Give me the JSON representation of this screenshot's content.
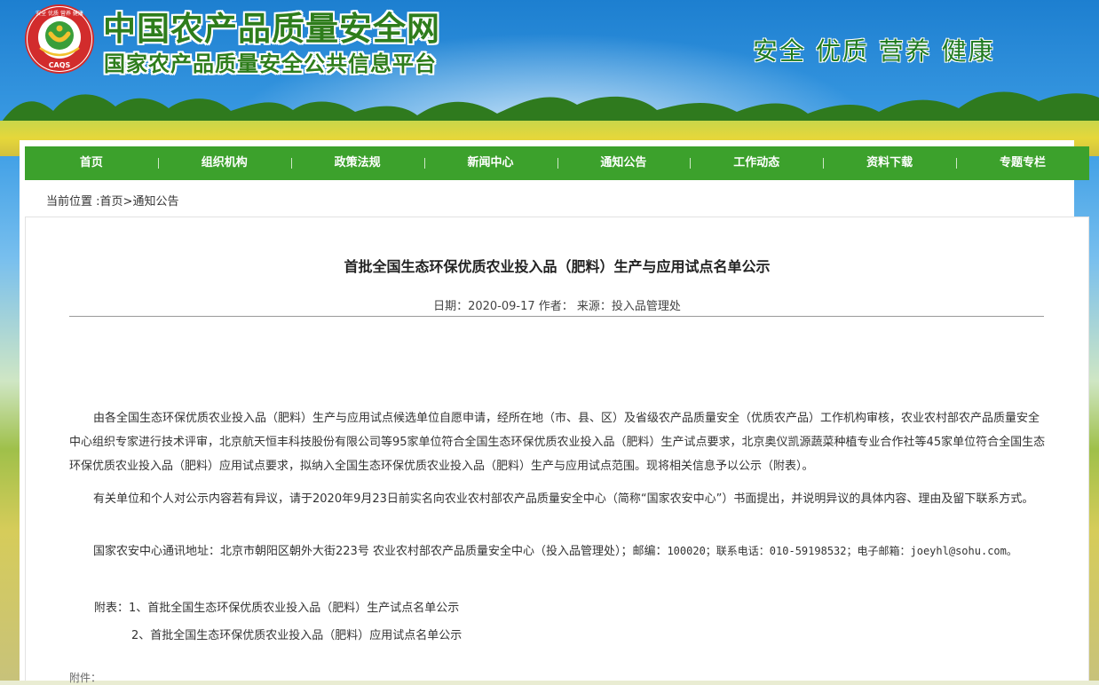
{
  "site": {
    "title": "中国农产品质量安全网",
    "subtitle": "国家农产品质量安全公共信息平台",
    "slogan": "安全 优质 营养 健康",
    "logo_text": "CAQS",
    "logo_ring_text": "安全 优质 营养 健康"
  },
  "nav": {
    "items": [
      "首页",
      "组织机构",
      "政策法规",
      "新闻中心",
      "通知公告",
      "工作动态",
      "资料下载",
      "专题专栏"
    ]
  },
  "breadcrumb": {
    "prefix": "当前位置 :",
    "home": "首页",
    "separator": ">",
    "current": "通知公告"
  },
  "article": {
    "title": "首批全国生态环保优质农业投入品（肥料）生产与应用试点名单公示",
    "meta": "日期：2020-09-17 作者： 来源：投入品管理处",
    "paragraph1": "由各全国生态环保优质农业投入品（肥料）生产与应用试点候选单位自愿申请，经所在地（市、县、区）及省级农产品质量安全（优质农产品）工作机构审核，农业农村部农产品质量安全中心组织专家进行技术评审，北京航天恒丰科技股份有限公司等95家单位符合全国生态环保优质农业投入品（肥料）生产试点要求，北京奥仪凯源蔬菜种植专业合作社等45家单位符合全国生态环保优质农业投入品（肥料）应用试点要求，拟纳入全国生态环保优质农业投入品（肥料）生产与应用试点范围。现将相关信息予以公示（附表）。",
    "paragraph2": "有关单位和个人对公示内容若有异议，请于2020年9月23日前实名向农业农村部农产品质量安全中心（简称“国家农安中心”）书面提出，并说明异议的具体内容、理由及留下联系方式。",
    "paragraph3_a": "国家农安中心通讯地址：北京市朝阳区朝外大街223号 农业农村部农产品质量安全中心（投入品管理处）；邮编：",
    "paragraph3_b": "100020；联系电话：010-59198532；电子邮箱：joeyhl@sohu.com。",
    "attachment1": "附表：1、首批全国生态环保优质农业投入品（肥料）生产试点名单公示",
    "attachment2": "2、首批全国生态环保优质农业投入品（肥料）应用试点名单公示",
    "attachments_label": "附件："
  },
  "colors": {
    "nav_green": "#3ca12c",
    "title_green": "#2e7d1c",
    "sky_blue": "#1d7fd0"
  }
}
